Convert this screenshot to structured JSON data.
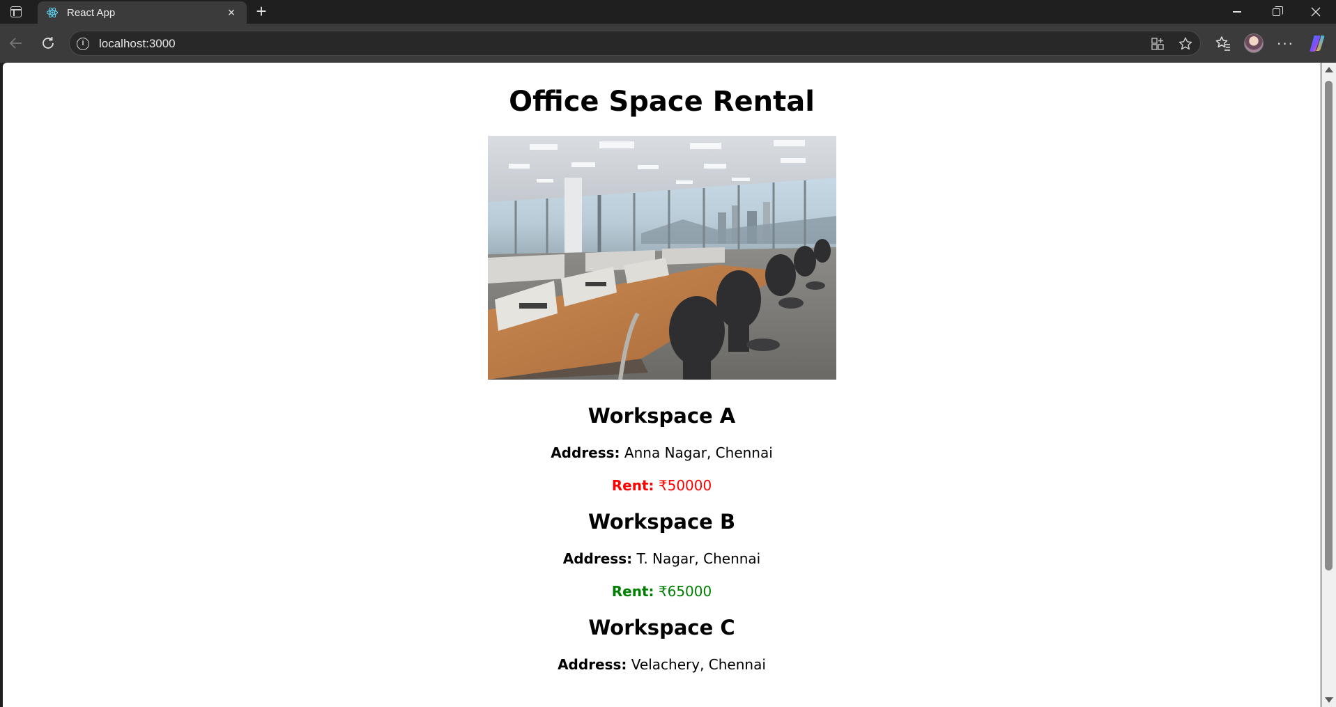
{
  "browser": {
    "tab_title": "React App",
    "url": "localhost:3000",
    "tab_close_glyph": "×",
    "new_tab_glyph": "+",
    "more_glyph": "···"
  },
  "page": {
    "title": "Office Space Rental",
    "image_alt": "Office Space",
    "workspaces": [
      {
        "name": "Workspace A",
        "address_label": "Address:",
        "address": "Anna Nagar, Chennai",
        "rent_label": "Rent:",
        "rent": "₹50000",
        "rent_color": "#ff0000"
      },
      {
        "name": "Workspace B",
        "address_label": "Address:",
        "address": "T. Nagar, Chennai",
        "rent_label": "Rent:",
        "rent": "₹65000",
        "rent_color": "#008000"
      },
      {
        "name": "Workspace C",
        "address_label": "Address:",
        "address": "Velachery, Chennai"
      }
    ]
  },
  "colors": {
    "rent_low": "#ff0000",
    "rent_high": "#008000",
    "browser_chrome": "#3b3b3b",
    "titlebar": "#1f1f1f"
  },
  "icons": [
    "tab-actions-icon",
    "react-icon",
    "close-icon",
    "plus-icon",
    "minimize-icon",
    "restore-icon",
    "window-close-icon",
    "back-arrow-icon",
    "reload-icon",
    "info-icon",
    "apps-icon",
    "star-icon",
    "favorites-icon",
    "more-icon",
    "copilot-icon"
  ]
}
